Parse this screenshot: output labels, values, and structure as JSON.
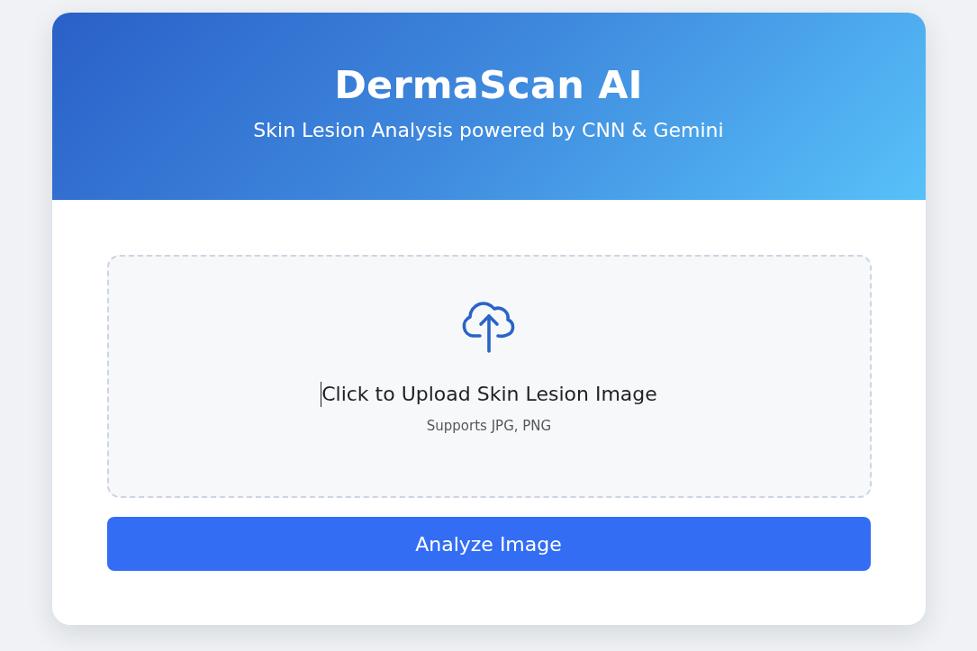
{
  "header": {
    "title": "DermaScan AI",
    "subtitle": "Skin Lesion Analysis powered by CNN & Gemini"
  },
  "upload": {
    "prompt": "Click to Upload Skin Lesion Image",
    "hint": "Supports JPG, PNG",
    "caret_visible": true
  },
  "button": {
    "label": "Analyze Image"
  }
}
